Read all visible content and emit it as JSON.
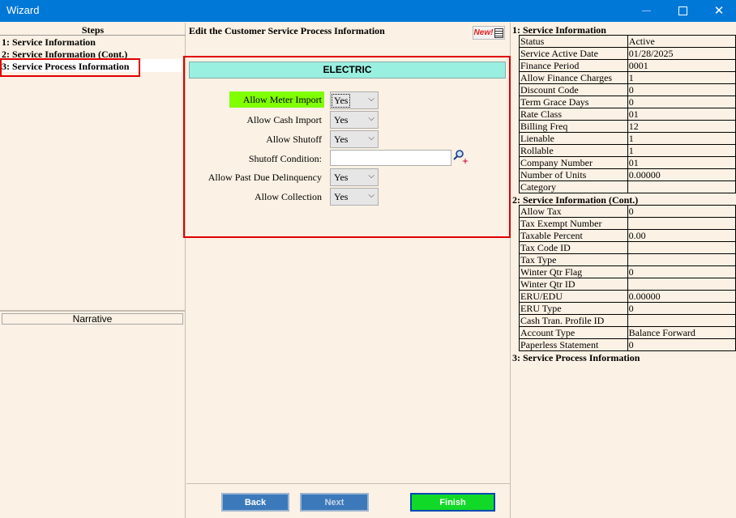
{
  "window": {
    "title": "Wizard"
  },
  "steps": {
    "header": "Steps",
    "items": [
      {
        "label": "1: Service Information"
      },
      {
        "label": "2: Service Information (Cont.)"
      },
      {
        "label": "3: Service Process Information"
      }
    ],
    "selected_index": 2
  },
  "narrative": {
    "header": "Narrative"
  },
  "main": {
    "title": "Edit the Customer Service Process Information",
    "new_badge": "New!",
    "section_header": "ELECTRIC",
    "fields": {
      "allow_meter_import": {
        "label": "Allow Meter Import",
        "value": "Yes"
      },
      "allow_cash_import": {
        "label": "Allow Cash Import",
        "value": "Yes"
      },
      "allow_shutoff": {
        "label": "Allow Shutoff",
        "value": "Yes"
      },
      "shutoff_condition": {
        "label": "Shutoff Condition:",
        "value": ""
      },
      "allow_past_due": {
        "label": "Allow Past Due Delinquency",
        "value": "Yes"
      },
      "allow_collection": {
        "label": "Allow Collection",
        "value": "Yes"
      }
    }
  },
  "buttons": {
    "back": "Back",
    "next": "Next",
    "finish": "Finish"
  },
  "summary": {
    "sections": [
      {
        "title": "1: Service Information",
        "rows": [
          {
            "key": "Status",
            "value": "Active"
          },
          {
            "key": "Service Active Date",
            "value": "01/28/2025"
          },
          {
            "key": "Finance Period",
            "value": "0001"
          },
          {
            "key": "Allow Finance Charges",
            "value": "1"
          },
          {
            "key": "Discount Code",
            "value": "0"
          },
          {
            "key": "Term Grace Days",
            "value": "0"
          },
          {
            "key": "Rate Class",
            "value": "01"
          },
          {
            "key": "Billing Freq",
            "value": "12"
          },
          {
            "key": "Lienable",
            "value": "1"
          },
          {
            "key": "Rollable",
            "value": "1"
          },
          {
            "key": "Company Number",
            "value": "01"
          },
          {
            "key": "Number of Units",
            "value": "0.00000"
          },
          {
            "key": "Category",
            "value": ""
          }
        ]
      },
      {
        "title": "2: Service Information (Cont.)",
        "rows": [
          {
            "key": "Allow Tax",
            "value": "0"
          },
          {
            "key": "Tax Exempt Number",
            "value": ""
          },
          {
            "key": "Taxable Percent",
            "value": "0.00"
          },
          {
            "key": "Tax Code ID",
            "value": ""
          },
          {
            "key": "Tax Type",
            "value": ""
          },
          {
            "key": "Winter Qtr Flag",
            "value": "0"
          },
          {
            "key": "Winter Qtr ID",
            "value": ""
          },
          {
            "key": "ERU/EDU",
            "value": "0.00000"
          },
          {
            "key": "ERU Type",
            "value": "0"
          },
          {
            "key": "Cash Tran. Profile ID",
            "value": ""
          },
          {
            "key": "Account Type",
            "value": "Balance Forward"
          },
          {
            "key": "Paperless Statement",
            "value": "0"
          }
        ]
      },
      {
        "title": "3: Service Process Information",
        "rows": []
      }
    ]
  },
  "colors": {
    "titlebar": "#0078d7",
    "background": "#fbf1e4",
    "electric_header": "#99f0e0",
    "highlight_label": "#80ff00",
    "finish_button": "#11d928",
    "nav_button": "#3b79ba",
    "annotation_box": "#e00000"
  }
}
